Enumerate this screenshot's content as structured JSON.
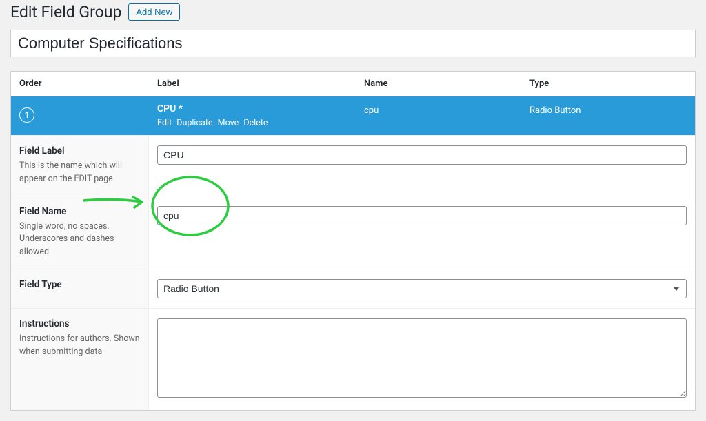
{
  "header": {
    "title": "Edit Field Group",
    "add_new": "Add New"
  },
  "group_title": "Computer Specifications",
  "columns": {
    "order": "Order",
    "label": "Label",
    "name": "Name",
    "type": "Type"
  },
  "field_row": {
    "order": "1",
    "label": "CPU *",
    "name": "cpu",
    "type": "Radio Button",
    "actions": {
      "edit": "Edit",
      "duplicate": "Duplicate",
      "move": "Move",
      "delete": "Delete"
    }
  },
  "settings": {
    "field_label": {
      "title": "Field Label",
      "desc": "This is the name which will appear on the EDIT page",
      "value": "CPU"
    },
    "field_name": {
      "title": "Field Name",
      "desc": "Single word, no spaces. Underscores and dashes allowed",
      "value": "cpu"
    },
    "field_type": {
      "title": "Field Type",
      "desc": "",
      "value": "Radio Button"
    },
    "instructions": {
      "title": "Instructions",
      "desc": "Instructions for authors. Shown when submitting data",
      "value": ""
    }
  }
}
